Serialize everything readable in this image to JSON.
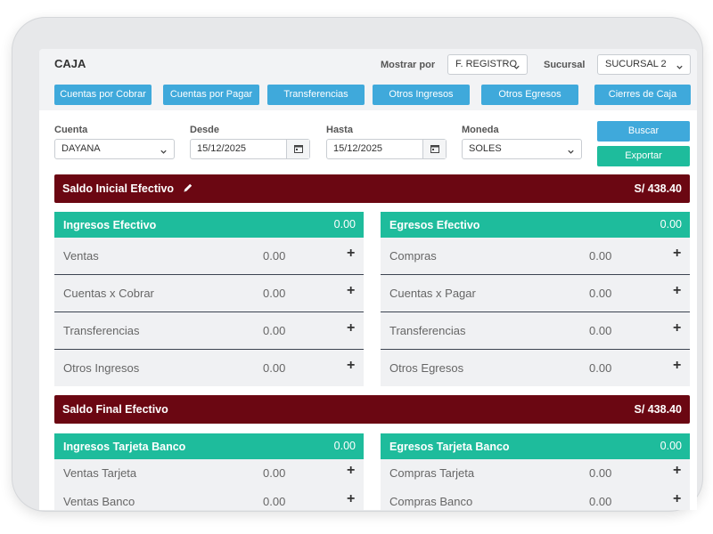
{
  "header": {
    "title": "CAJA",
    "mostrar_label": "Mostrar por",
    "mostrar_value": "F. REGISTRO",
    "sucursal_label": "Sucursal",
    "sucursal_value": "SUCURSAL 2"
  },
  "nav": {
    "cuentas_cobrar": "Cuentas por Cobrar",
    "cuentas_pagar": "Cuentas por Pagar",
    "transferencias": "Transferencias",
    "otros_ingresos": "Otros Ingresos",
    "otros_egresos": "Otros Egresos",
    "cierres_caja": "Cierres de Caja"
  },
  "filters": {
    "cuenta_label": "Cuenta",
    "cuenta_value": "DAYANA",
    "desde_label": "Desde",
    "desde_value": "15/12/2025",
    "hasta_label": "Hasta",
    "hasta_value": "15/12/2025",
    "moneda_label": "Moneda",
    "moneda_value": "SOLES",
    "buscar": "Buscar",
    "exportar": "Exportar"
  },
  "saldo_inicial": {
    "label": "Saldo Inicial Efectivo",
    "value": "S/ 438.40"
  },
  "ingresos_efectivo": {
    "title": "Ingresos Efectivo",
    "total": "0.00",
    "rows": [
      {
        "label": "Ventas",
        "value": "0.00"
      },
      {
        "label": "Cuentas x Cobrar",
        "value": "0.00"
      },
      {
        "label": "Transferencias",
        "value": "0.00"
      },
      {
        "label": "Otros Ingresos",
        "value": "0.00"
      }
    ]
  },
  "egresos_efectivo": {
    "title": "Egresos Efectivo",
    "total": "0.00",
    "rows": [
      {
        "label": "Compras",
        "value": "0.00"
      },
      {
        "label": "Cuentas x Pagar",
        "value": "0.00"
      },
      {
        "label": "Transferencias",
        "value": "0.00"
      },
      {
        "label": "Otros Egresos",
        "value": "0.00"
      }
    ]
  },
  "saldo_final": {
    "label": "Saldo Final Efectivo",
    "value": "S/ 438.40"
  },
  "ingresos_banco": {
    "title": "Ingresos Tarjeta Banco",
    "total": "0.00",
    "rows": [
      {
        "label": "Ventas Tarjeta",
        "value": "0.00"
      },
      {
        "label": "Ventas Banco",
        "value": "0.00"
      }
    ]
  },
  "egresos_banco": {
    "title": "Egresos Tarjeta Banco",
    "total": "0.00",
    "rows": [
      {
        "label": "Compras Tarjeta",
        "value": "0.00"
      },
      {
        "label": "Compras Banco",
        "value": "0.00"
      }
    ]
  },
  "plus_symbol": "+",
  "colors": {
    "primary": "#3fa9db",
    "success": "#1ebc9c",
    "danger": "#6b0712"
  }
}
